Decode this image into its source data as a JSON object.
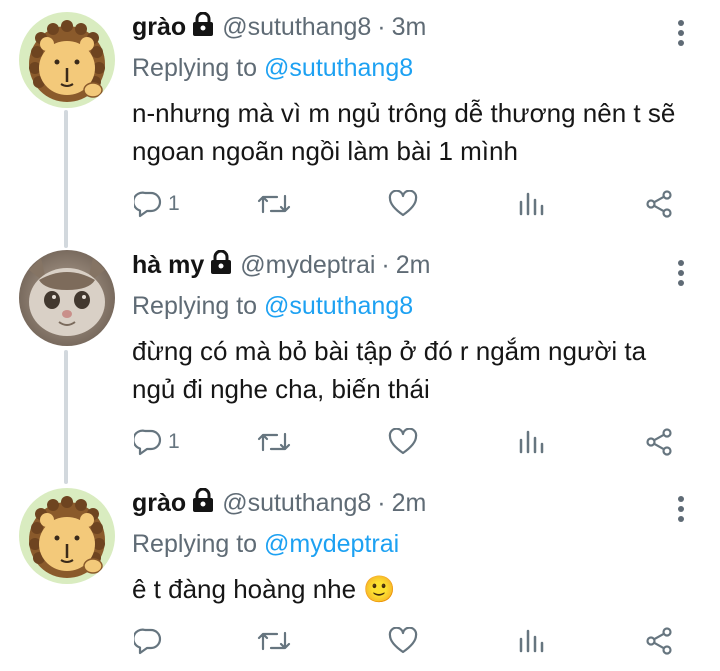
{
  "tweets": [
    {
      "name": "grào",
      "handle": "@sututhang8",
      "separator": "·",
      "time": "3m",
      "reply_prefix": "Replying to",
      "reply_to": "@sututhang8",
      "text": "n-nhưng mà vì m ngủ trông dễ thương nên t sẽ ngoan ngoãn ngồi làm bài 1 mình",
      "reply_count": "1",
      "avatar": "lion-cartoon-avatar"
    },
    {
      "name": "hà my",
      "handle": "@mydeptrai",
      "separator": "·",
      "time": "2m",
      "reply_prefix": "Replying to",
      "reply_to": "@sututhang8",
      "text": "đừng có mà bỏ bài tập ở đó r ngắm người ta ngủ đi nghe cha, biến thái",
      "reply_count": "1",
      "avatar": "cat-photo-avatar"
    },
    {
      "name": "grào",
      "handle": "@sututhang8",
      "separator": "·",
      "time": "2m",
      "reply_prefix": "Replying to",
      "reply_to": "@mydeptrai",
      "text": "ê t đàng hoàng nhe",
      "emoji": "🙂",
      "reply_count": "",
      "avatar": "lion-cartoon-avatar"
    }
  ],
  "icons": {
    "reply": "reply-icon",
    "retweet": "retweet-icon",
    "like": "like-icon",
    "analytics": "analytics-icon",
    "share": "share-icon",
    "lock": "lock-icon",
    "more": "more-options-icon"
  },
  "colors": {
    "link": "#1da1f2",
    "muted": "#5f6b75",
    "icon": "#66757f",
    "thread_line": "#d2d8dd"
  }
}
